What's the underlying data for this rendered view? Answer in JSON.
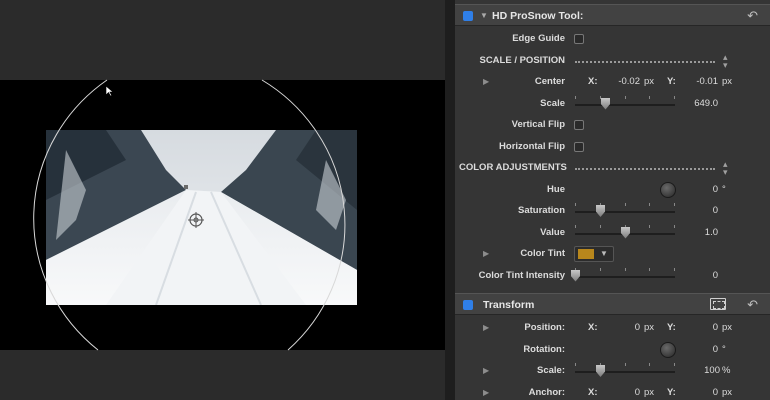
{
  "colors": {
    "accent": "#2f7fe8",
    "tint": "#b8871c"
  },
  "effect": {
    "title": "HD ProSnow Tool:",
    "rows": [
      {
        "type": "checkbox",
        "label": "Edge Guide"
      },
      {
        "type": "group",
        "label": "SCALE / POSITION"
      },
      {
        "type": "point",
        "label": "Center",
        "x_label": "X:",
        "x_value": "-0.02",
        "x_unit": "px",
        "y_label": "Y:",
        "y_value": "-0.01",
        "y_unit": "px"
      },
      {
        "type": "slider",
        "label": "Scale",
        "value": "649.0",
        "level": 0.3
      },
      {
        "type": "checkbox",
        "label": "Vertical Flip"
      },
      {
        "type": "checkbox",
        "label": "Horizontal Flip"
      },
      {
        "type": "group",
        "label": "COLOR ADJUSTMENTS"
      },
      {
        "type": "angle",
        "label": "Hue",
        "value": "0",
        "unit": "°"
      },
      {
        "type": "slider",
        "label": "Saturation",
        "value": "0",
        "level": 0.25
      },
      {
        "type": "slider",
        "label": "Value",
        "value": "1.0",
        "level": 0.5
      },
      {
        "type": "color",
        "label": "Color Tint"
      },
      {
        "type": "slider",
        "label": "Color Tint Intensity",
        "value": "0",
        "level": 0.0
      }
    ]
  },
  "transform": {
    "title": "Transform",
    "rows": [
      {
        "type": "point",
        "label": "Position:",
        "x_label": "X:",
        "x_value": "0",
        "x_unit": "px",
        "y_label": "Y:",
        "y_value": "0",
        "y_unit": "px"
      },
      {
        "type": "angle",
        "label": "Rotation:",
        "value": "0",
        "unit": "°"
      },
      {
        "type": "slider",
        "label": "Scale:",
        "value": "100",
        "unit": "%",
        "level": 0.25
      },
      {
        "type": "point",
        "label": "Anchor:",
        "x_label": "X:",
        "x_value": "0",
        "x_unit": "px",
        "y_label": "Y:",
        "y_value": "0",
        "y_unit": "px"
      }
    ]
  }
}
